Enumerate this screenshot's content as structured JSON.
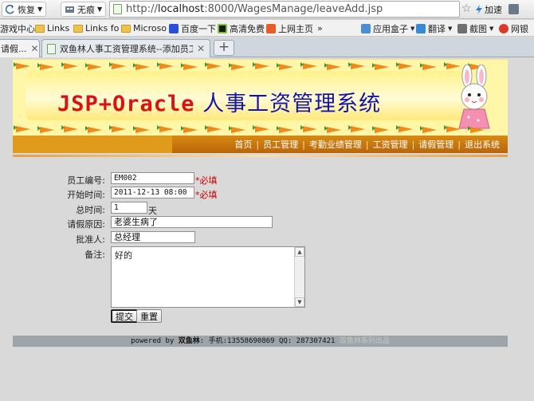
{
  "browser": {
    "back_label": "恢复",
    "mode_label": "无痕",
    "url_prefix": "http://",
    "url_host": "localhost",
    "url_path": ":8000/WagesManage/leaveAdd.jsp",
    "accel_label": "加速",
    "extra_label": "»"
  },
  "bookmarks": [
    {
      "label": "游戏中心"
    },
    {
      "label": "Links"
    },
    {
      "label": "Links fo"
    },
    {
      "label": "Microso"
    },
    {
      "label": "百度一下"
    },
    {
      "label": "高清免费"
    },
    {
      "label": "上网主页"
    },
    {
      "label": "»"
    },
    {
      "label": "应用盒子"
    },
    {
      "label": "翻译"
    },
    {
      "label": "截图"
    },
    {
      "label": "网银"
    }
  ],
  "tabs": [
    {
      "label": "请假..."
    },
    {
      "label": "双鱼林人事工资管理系统--添加员工..."
    }
  ],
  "header": {
    "title_en": "JSP+Oracle",
    "title_cn": " 人事工资管理系统",
    "nav": [
      "首页",
      "员工管理",
      "考勤业绩管理",
      "工资管理",
      "请假管理",
      "退出系统"
    ]
  },
  "form": {
    "employee_no": {
      "label": "员工编号:",
      "value": "EM002",
      "required": "*必填"
    },
    "start_time": {
      "label": "开始时间:",
      "value": "2011-12-13 08:00",
      "required": "*必填"
    },
    "total_time": {
      "label": "总时间:",
      "value": "1",
      "unit": "天"
    },
    "reason": {
      "label": "请假原因:",
      "value": "老婆生病了"
    },
    "approver": {
      "label": "批准人:",
      "value": "总经理"
    },
    "remark": {
      "label": "备注:",
      "value": "好的"
    },
    "submit_label": "提交",
    "reset_label": "重置"
  },
  "footer": {
    "powered": "powered by ",
    "author": "双鱼林",
    "contact": ": 手机:13558690869 QQ: 287307421 ",
    "brand": "双鱼林系列出品"
  }
}
